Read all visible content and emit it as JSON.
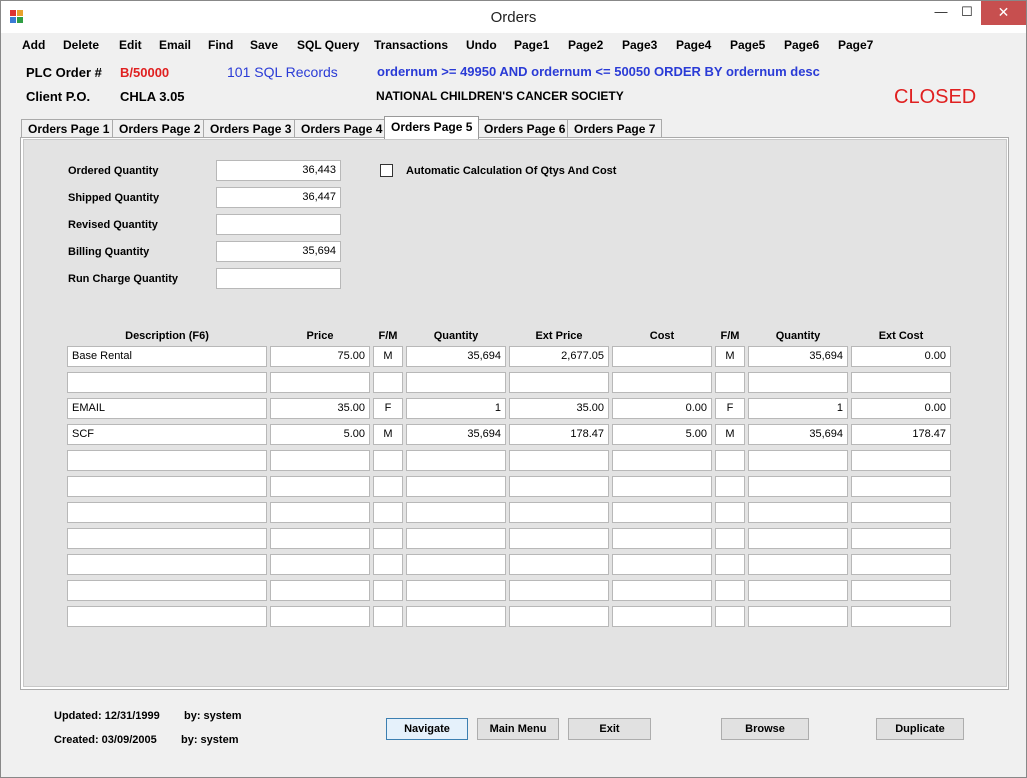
{
  "window": {
    "title": "Orders"
  },
  "menu": [
    "Add",
    "Delete",
    "Edit",
    "Email",
    "Find",
    "Save",
    "SQL Query",
    "Transactions",
    "Undo",
    "Page1",
    "Page2",
    "Page3",
    "Page4",
    "Page5",
    "Page6",
    "Page7"
  ],
  "header": {
    "plc_label": "PLC Order #",
    "order_number": "B/50000",
    "record_count": "101 SQL Records",
    "query": "ordernum >= 49950 AND ordernum <= 50050 ORDER BY ordernum desc",
    "client_po_label": "Client P.O.",
    "client_po": "CHLA 3.05",
    "customer": "NATIONAL CHILDREN'S CANCER SOCIETY",
    "status": "CLOSED"
  },
  "tabs": [
    "Orders Page 1",
    "Orders Page 2",
    "Orders Page 3",
    "Orders Page 4",
    "Orders Page 5",
    "Orders Page 6",
    "Orders Page 7"
  ],
  "active_tab": "Orders Page 5",
  "quantities": [
    {
      "label": "Ordered Quantity",
      "value": "36,443"
    },
    {
      "label": "Shipped Quantity",
      "value": "36,447"
    },
    {
      "label": "Revised Quantity",
      "value": ""
    },
    {
      "label": "Billing Quantity",
      "value": "35,694"
    },
    {
      "label": "Run Charge Quantity",
      "value": ""
    }
  ],
  "auto_calc": {
    "label": "Automatic Calculation Of Qtys And Cost",
    "checked": false
  },
  "grid": {
    "headers": [
      "Description  (F6)",
      "Price",
      "F/M",
      "Quantity",
      "Ext Price",
      "Cost",
      "F/M",
      "Quantity",
      "Ext Cost"
    ],
    "rows": [
      [
        "Base Rental",
        "75.00",
        "M",
        "35,694",
        "2,677.05",
        "",
        "M",
        "35,694",
        "0.00"
      ],
      [
        "",
        "",
        "",
        "",
        "",
        "",
        "",
        "",
        ""
      ],
      [
        "EMAIL",
        "35.00",
        "F",
        "1",
        "35.00",
        "0.00",
        "F",
        "1",
        "0.00"
      ],
      [
        "SCF",
        "5.00",
        "M",
        "35,694",
        "178.47",
        "5.00",
        "M",
        "35,694",
        "178.47"
      ],
      [
        "",
        "",
        "",
        "",
        "",
        "",
        "",
        "",
        ""
      ],
      [
        "",
        "",
        "",
        "",
        "",
        "",
        "",
        "",
        ""
      ],
      [
        "",
        "",
        "",
        "",
        "",
        "",
        "",
        "",
        ""
      ],
      [
        "",
        "",
        "",
        "",
        "",
        "",
        "",
        "",
        ""
      ],
      [
        "",
        "",
        "",
        "",
        "",
        "",
        "",
        "",
        ""
      ],
      [
        "",
        "",
        "",
        "",
        "",
        "",
        "",
        "",
        ""
      ],
      [
        "",
        "",
        "",
        "",
        "",
        "",
        "",
        "",
        ""
      ]
    ]
  },
  "footer": {
    "updated": "Updated: 12/31/1999",
    "updated_by": "by: system",
    "created": "Created: 03/09/2005",
    "created_by": "by: system"
  },
  "buttons": [
    "Navigate",
    "Main Menu",
    "Exit",
    "Browse",
    "Duplicate"
  ],
  "colors": {
    "highlight_red": "#e02020",
    "query_blue": "#2a3bd6",
    "close_button": "#c74f4f"
  }
}
